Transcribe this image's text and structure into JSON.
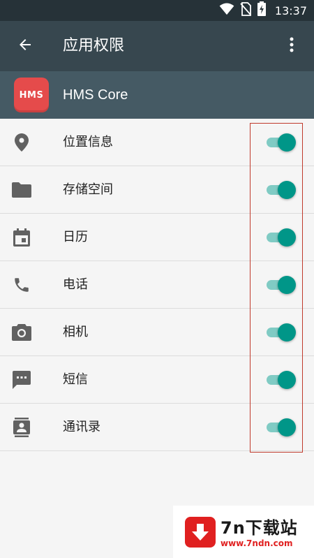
{
  "status_bar": {
    "time": "13:37",
    "icons": [
      "wifi-icon",
      "no-sim-icon",
      "battery-charging-icon"
    ]
  },
  "app_bar": {
    "title": "应用权限",
    "back_icon": "arrow-back-icon",
    "menu_icon": "more-vert-icon"
  },
  "app_header": {
    "icon_text": "HMS",
    "name": "HMS Core"
  },
  "permissions": [
    {
      "label": "位置信息",
      "icon": "location-pin-icon",
      "enabled": true
    },
    {
      "label": "存储空间",
      "icon": "folder-icon",
      "enabled": true
    },
    {
      "label": "日历",
      "icon": "calendar-icon",
      "enabled": true
    },
    {
      "label": "电话",
      "icon": "phone-icon",
      "enabled": true
    },
    {
      "label": "相机",
      "icon": "camera-icon",
      "enabled": true
    },
    {
      "label": "短信",
      "icon": "sms-icon",
      "enabled": true
    },
    {
      "label": "通讯录",
      "icon": "contacts-icon",
      "enabled": true
    }
  ],
  "watermark": {
    "title": "7n下载站",
    "url": "www.7ndn.com"
  },
  "colors": {
    "status_bar": "#263238",
    "app_bar": "#37474f",
    "app_header": "#455a64",
    "app_icon": "#e54b4b",
    "toggle_thumb": "#009688",
    "toggle_track": "#80cbc4",
    "highlight": "#c0392b",
    "watermark_red": "#e02020"
  }
}
